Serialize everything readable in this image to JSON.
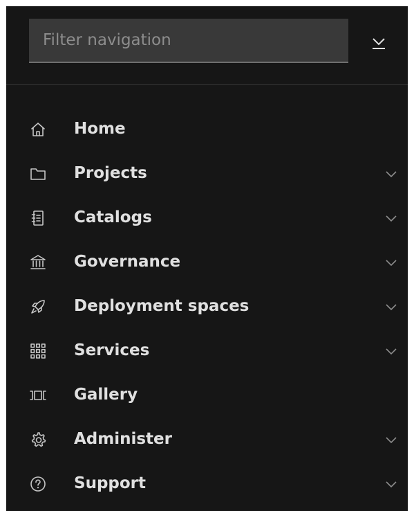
{
  "filter": {
    "placeholder": "Filter navigation"
  },
  "nav": {
    "items": [
      {
        "label": "Home",
        "icon": "home-icon",
        "expandable": false
      },
      {
        "label": "Projects",
        "icon": "folder-icon",
        "expandable": true
      },
      {
        "label": "Catalogs",
        "icon": "catalog-icon",
        "expandable": true
      },
      {
        "label": "Governance",
        "icon": "bank-icon",
        "expandable": true
      },
      {
        "label": "Deployment spaces",
        "icon": "rocket-icon",
        "expandable": true
      },
      {
        "label": "Services",
        "icon": "grid-icon",
        "expandable": true
      },
      {
        "label": "Gallery",
        "icon": "carousel-icon",
        "expandable": false
      },
      {
        "label": "Administer",
        "icon": "settings-icon",
        "expandable": true
      },
      {
        "label": "Support",
        "icon": "help-icon",
        "expandable": true
      }
    ]
  },
  "colors": {
    "panel_background": "#161616",
    "input_background": "#393939",
    "text": "#e0e0e0",
    "placeholder": "#8d8d8d",
    "icon": "#c6c6c6"
  }
}
